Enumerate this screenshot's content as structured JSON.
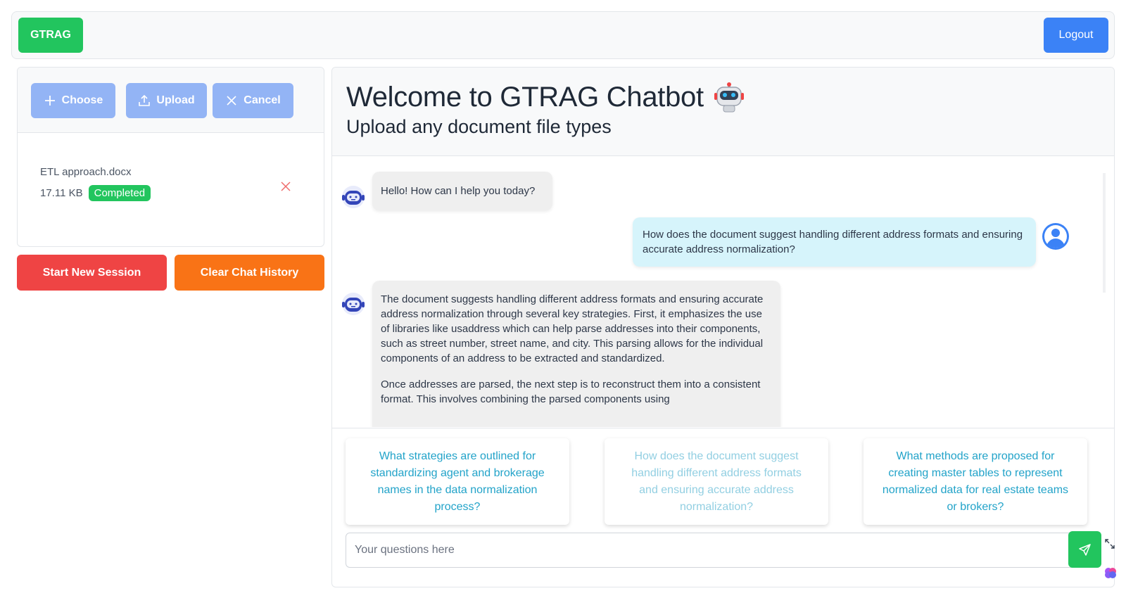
{
  "navbar": {
    "brand_label": "GTRAG",
    "logout_label": "Logout"
  },
  "upload": {
    "choose_label": "Choose",
    "upload_label": "Upload",
    "cancel_label": "Cancel",
    "file": {
      "name": "ETL approach.docx",
      "size": "17.11 KB",
      "status": "Completed"
    }
  },
  "session": {
    "start_label": "Start New Session",
    "clear_label": "Clear Chat History"
  },
  "chat": {
    "title": "Welcome to GTRAG Chatbot",
    "subtitle": "Upload any document file types",
    "messages": [
      {
        "role": "bot",
        "paragraphs": [
          "Hello! How can I help you today?"
        ]
      },
      {
        "role": "user",
        "paragraphs": [
          "How does the document suggest handling different address formats and ensuring accurate address normalization?"
        ]
      },
      {
        "role": "bot",
        "paragraphs": [
          "The document suggests handling different address formats and ensuring accurate address normalization through several key strategies. First, it emphasizes the use of libraries like usaddress which can help parse addresses into their components, such as street number, street name, and city. This parsing allows for the individual components of an address to be extracted and standardized.",
          "Once addresses are parsed, the next step is to reconstruct them into a consistent format. This involves combining the parsed components using"
        ]
      }
    ],
    "suggestions": [
      "What strategies are outlined for standardizing agent and brokerage names in the data normalization process?",
      "How does the document suggest handling different address formats and ensuring accurate address normalization?",
      "What methods are proposed for creating master tables to represent normalized data for real estate teams or brokers?"
    ],
    "input_placeholder": "Your questions here"
  },
  "colors": {
    "brand_green": "#22c55e",
    "logout_blue": "#3b82f6",
    "upload_buttons": "#93b4f5",
    "start_session_red": "#ef4444",
    "clear_history_orange": "#f97316",
    "suggestion_text": "#22a3c9",
    "user_bubble": "#d6f4fb",
    "bot_bubble": "#efefef"
  },
  "icons": {
    "bot_avatar": "robot-icon",
    "user_avatar": "user-icon",
    "title_emoji": "robot-face-icon",
    "send": "send-icon",
    "remove_file": "close-icon"
  }
}
